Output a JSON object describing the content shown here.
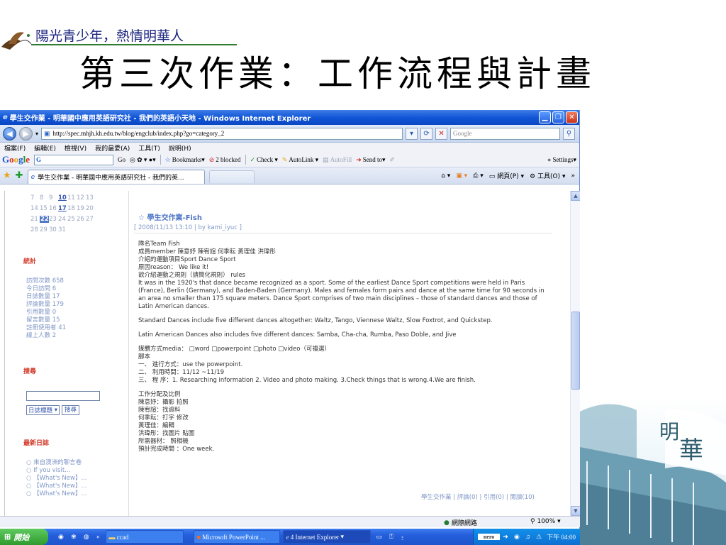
{
  "slide": {
    "slogan": "陽光青少年，熱情明華人",
    "title": "第三次作業：工作流程與計畫",
    "deco_chars": [
      "明",
      "華"
    ]
  },
  "window": {
    "title": "學生交作業 - 明華國中應用英語研究社 - 我們的英語小天地 - Windows Internet Explorer",
    "url": "http://spec.mhjh.kh.edu.tw/blog/engclub/index.php?go=category_2",
    "search_placeholder": "Google"
  },
  "menu": [
    "檔案(F)",
    "編輯(E)",
    "檢視(V)",
    "我的最愛(A)",
    "工具(T)",
    "說明(H)"
  ],
  "google_toolbar": {
    "box": "G",
    "items": [
      "Go",
      "Bookmarks▾",
      "2 blocked",
      "Check ▾",
      "AutoLink ▾",
      "AutoFill",
      "Send to▾",
      "Settings▾"
    ]
  },
  "tab": {
    "label": "學生交作業 - 明華國中應用英語研究社 - 我們的英...",
    "right": [
      "網頁(P) ▾",
      "工具(O) ▾"
    ]
  },
  "calendar": {
    "rows": [
      [
        "7",
        "8",
        "9",
        "10",
        "11",
        "12",
        "13"
      ],
      [
        "14",
        "15",
        "16",
        "17",
        "18",
        "19",
        "20"
      ],
      [
        "21",
        "22",
        "23",
        "24",
        "25",
        "26",
        "27"
      ],
      [
        "28",
        "29",
        "30",
        "31"
      ]
    ]
  },
  "sidebar": {
    "stats_title": "統計",
    "stats": [
      "訪問次數 658",
      "今日訪問 6",
      "日誌數量 17",
      "評論數量 179",
      "引用數量 0",
      "留言數量 15",
      "註冊使用者 41",
      "線上人數 2"
    ],
    "search_title": "搜尋",
    "search_select": "日誌標題",
    "search_button": "搜尋",
    "recent_title": "最新日誌",
    "recent": [
      "來自澳洲的聊言卷",
      "If you visit...",
      "【What's New】...",
      "【What's New】...",
      "【What's New】..."
    ]
  },
  "post": {
    "title": "學生交作業-Fish",
    "meta": "[ 2008/11/13 13:10 | by kami_iyuc ]",
    "lines_a": [
      "隊名Team  Fish",
      "成員member  陳意妤 陳宥諠 何季耘 黃理佳 洪瑋彤",
      "介紹的運動項目Sport  Dance Sport",
      "原因reason：  We like it!",
      "欲介紹運動之規則（請簡化規則） rules"
    ],
    "para1": "It was in the 1920's that dance became recognized as a sport. Some of the earliest Dance Sport competitions were held in Paris (France), Berlin (Germany), and Baden-Baden (Germany). Males and females form pairs and dance at the same time for 90 seconds in an area no smaller than 175 square meters. Dance Sport comprises of two main disciplines – those of standard dances and those of Latin American dances.",
    "para2": "Standard Dances include five different dances altogether: Waltz, Tango, Viennese Waltz, Slow Foxtrot, and Quickstep.",
    "para3": "Latin American Dances also includes five different dances: Samba, Cha-cha, Rumba, Paso Doble, and Jive",
    "lines_b": [
      "媒體方式media：  □word  □powerpoint  □photo  □video（可複選）",
      "腳本",
      "一、  進行方式：use the powerpoint.",
      "二、  利用時間：11/12 ~11/19",
      "三、  程    序：1. Researching information 2. Video and photo making. 3.Check things that is wrong.4.We are finish."
    ],
    "lines_c": [
      "工作分配及比例",
      "陳意妤：攝影 拍照",
      "陳宥諠：找資料",
      "何季耘：打字 修改",
      "黃理佳：編輯",
      "洪瑋彤：找圖片 貼圖",
      "所需器材：  照相機",
      "預計完成時間 ：One week."
    ],
    "footer": "學生交作業 | 評論(0) | 引用(0) | 閱讀(10)"
  },
  "status": {
    "zone": "網際網路",
    "zoom": "100%"
  },
  "taskbar": {
    "start": "開始",
    "items": [
      "ccad",
      "Microsoft PowerPoint ...",
      "4 Internet Explorer"
    ],
    "tray_brand": "nero",
    "clock": "下午 04:00"
  }
}
